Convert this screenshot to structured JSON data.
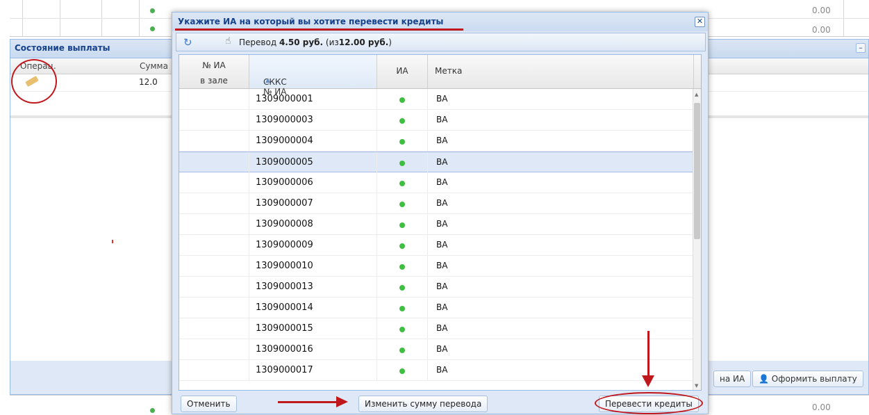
{
  "background": {
    "top_values": [
      "0.00",
      "0.00"
    ],
    "bottom_value": "0.00",
    "panel": {
      "title": "Состояние выплаты",
      "collapse_icon": "minus-icon",
      "columns": [
        "Операц.",
        "Сумма"
      ],
      "row_amount": "12.0"
    },
    "footer_buttons": [
      {
        "label": "на ИА",
        "icon": null
      },
      {
        "label": "Оформить выплату",
        "icon": "user-icon"
      }
    ]
  },
  "modal": {
    "title": "Укажите ИА на который вы хотите перевести кредиты",
    "close_symbol": "✕",
    "toolbar": {
      "prefix": "Перевод",
      "amount": "4.50 руб.",
      "middle": "(из",
      "total": "12.00 руб.",
      "suffix": ")"
    },
    "grid": {
      "columns": {
        "no_line1": "№ ИА",
        "no_line2": "в зале",
        "ckkc": "СККС № ИА",
        "ia": "ИА",
        "label": "Метка"
      },
      "rows": [
        {
          "ckkc": "1309000001",
          "label": "ВА",
          "status_color": "#3fbf3f"
        },
        {
          "ckkc": "1309000003",
          "label": "ВА",
          "status_color": "#3fbf3f"
        },
        {
          "ckkc": "1309000004",
          "label": "ВА",
          "status_color": "#3fbf3f"
        },
        {
          "ckkc": "1309000005",
          "label": "ВА",
          "status_color": "#3fbf3f",
          "selected": true
        },
        {
          "ckkc": "1309000006",
          "label": "ВА",
          "status_color": "#3fbf3f"
        },
        {
          "ckkc": "1309000007",
          "label": "ВА",
          "status_color": "#3fbf3f"
        },
        {
          "ckkc": "1309000008",
          "label": "ВА",
          "status_color": "#3fbf3f"
        },
        {
          "ckkc": "1309000009",
          "label": "ВА",
          "status_color": "#3fbf3f"
        },
        {
          "ckkc": "1309000010",
          "label": "ВА",
          "status_color": "#3fbf3f"
        },
        {
          "ckkc": "1309000013",
          "label": "ВА",
          "status_color": "#3fbf3f"
        },
        {
          "ckkc": "1309000014",
          "label": "ВА",
          "status_color": "#3fbf3f"
        },
        {
          "ckkc": "1309000015",
          "label": "ВА",
          "status_color": "#3fbf3f"
        },
        {
          "ckkc": "1309000016",
          "label": "ВА",
          "status_color": "#3fbf3f"
        },
        {
          "ckkc": "1309000017",
          "label": "ВА",
          "status_color": "#3fbf3f"
        }
      ]
    },
    "buttons": {
      "cancel": "Отменить",
      "change_amount": "Изменить сумму перевода",
      "transfer": "Перевести кредиты"
    }
  },
  "colors": {
    "header_text": "#15428b",
    "annotation": "#c0171d",
    "selected_row": "#dfe8f6"
  }
}
